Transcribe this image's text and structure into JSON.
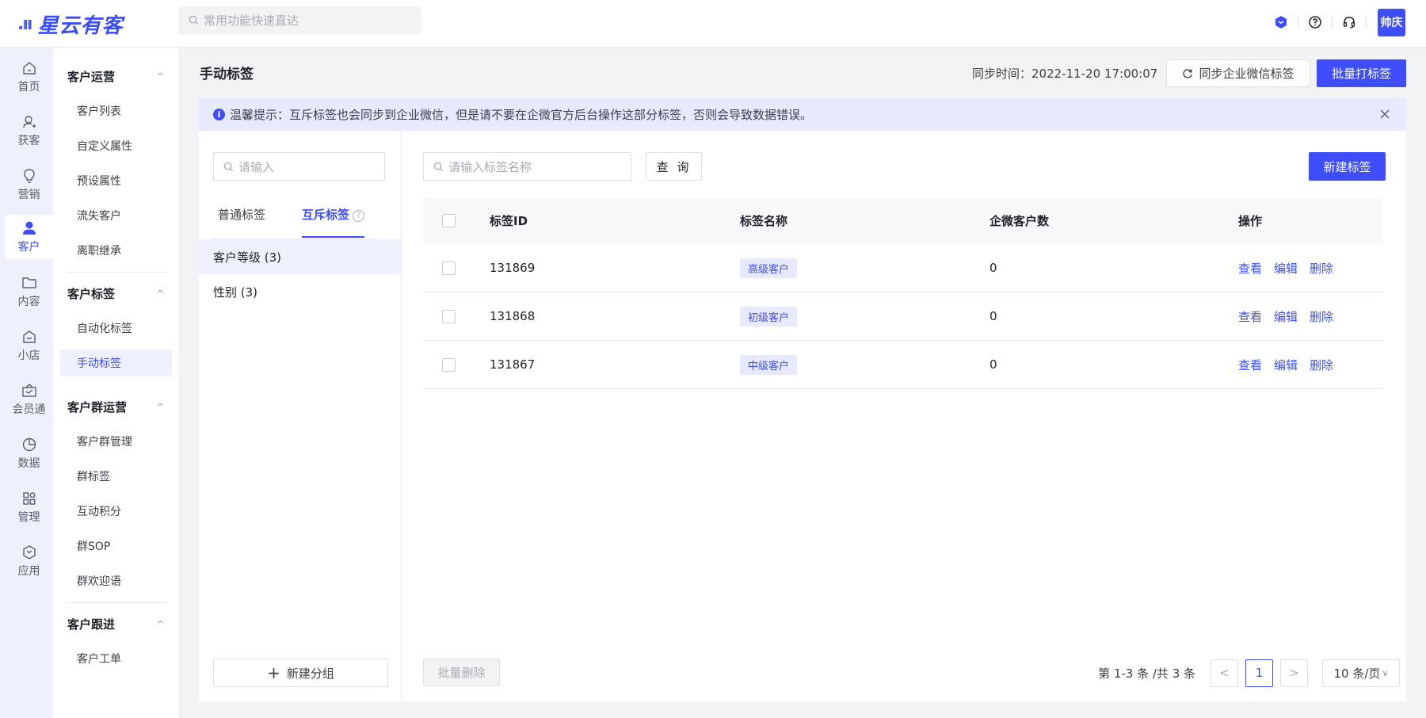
{
  "app": {
    "logo_mark": ".ıı",
    "logo_text": "星云有客"
  },
  "topbar": {
    "search_placeholder": "常用功能快速直达",
    "user_avatar": "帅庆",
    "icons": [
      "brand-cube-icon",
      "help-icon",
      "headset-icon"
    ]
  },
  "rail": {
    "items": [
      {
        "label": "首页",
        "icon": "home-icon"
      },
      {
        "label": "获客",
        "icon": "user-add-icon"
      },
      {
        "label": "营销",
        "icon": "bulb-icon"
      },
      {
        "label": "客户",
        "icon": "user-icon",
        "active": true
      },
      {
        "label": "内容",
        "icon": "folder-icon"
      },
      {
        "label": "小店",
        "icon": "shop-icon"
      },
      {
        "label": "会员通",
        "icon": "member-icon"
      },
      {
        "label": "数据",
        "icon": "pie-icon"
      },
      {
        "label": "管理",
        "icon": "grid-icon"
      },
      {
        "label": "应用",
        "icon": "cube-icon"
      }
    ]
  },
  "subnav": {
    "groups": [
      {
        "title": "客户运营",
        "items": [
          "客户列表",
          "自定义属性",
          "预设属性",
          "流失客户",
          "离职继承"
        ]
      },
      {
        "title": "客户标签",
        "items": [
          "自动化标签",
          "手动标签"
        ]
      },
      {
        "title": "客户群运营",
        "items": [
          "客户群管理",
          "群标签",
          "互动积分",
          "群SOP",
          "群欢迎语"
        ]
      },
      {
        "title": "客户跟进",
        "items": [
          "客户工单"
        ]
      }
    ],
    "active_item": "手动标签"
  },
  "header": {
    "title": "手动标签",
    "sync_time": "同步时间：2022-11-20 17:00:07",
    "sync_button": "同步企业微信标签",
    "batch_button": "批量打标签"
  },
  "notice": {
    "text": "温馨提示：互斥标签也会同步到企业微信，但是请不要在企微官方后台操作这部分标签，否则会导致数据错误。"
  },
  "left_pane": {
    "search_placeholder": "请输入",
    "tabs": [
      {
        "label": "普通标签"
      },
      {
        "label": "互斥标签",
        "active": true
      }
    ],
    "groups": [
      {
        "label": "客户等级 (3)",
        "active": true
      },
      {
        "label": "性别 (3)"
      }
    ],
    "new_group_button": "新建分组"
  },
  "toolbar": {
    "search_placeholder": "请输入标签名称",
    "query_button": "查 询",
    "new_tag_button": "新建标签"
  },
  "table": {
    "columns": [
      "标签ID",
      "标签名称",
      "企微客户数",
      "操作"
    ],
    "rows": [
      {
        "id": "131869",
        "name": "高级客户",
        "count": "0",
        "actions": [
          "查看",
          "编辑",
          "删除"
        ]
      },
      {
        "id": "131868",
        "name": "初级客户",
        "count": "0",
        "actions": [
          "查看",
          "编辑",
          "删除"
        ]
      },
      {
        "id": "131867",
        "name": "中级客户",
        "count": "0",
        "actions": [
          "查看",
          "编辑",
          "删除"
        ]
      }
    ]
  },
  "footer": {
    "bulk_delete_button": "批量删除",
    "total_text": "第 1-3 条 /共 3 条",
    "prev": "<",
    "current_page": "1",
    "next": ">",
    "page_size": "10 条/页"
  },
  "colors": {
    "primary": "#3d4dff",
    "light_primary": "#e7eaff",
    "rail_bg": "#eef0fe"
  }
}
